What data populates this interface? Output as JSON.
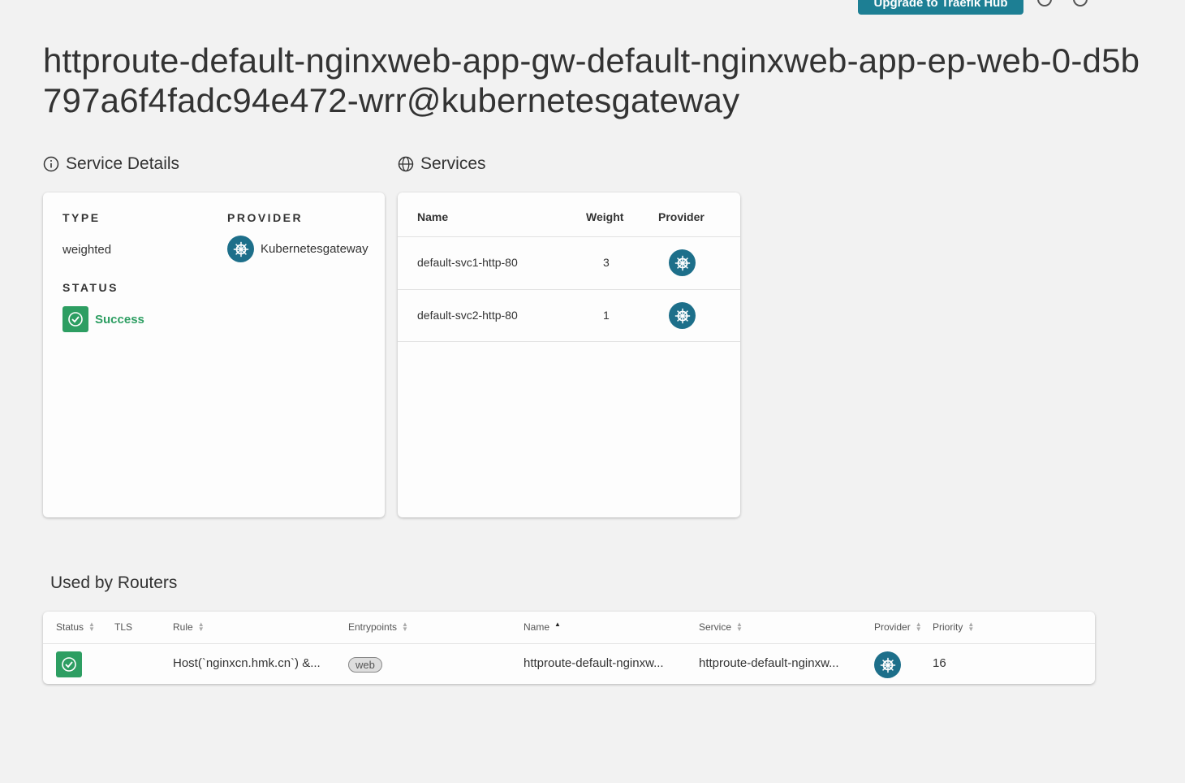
{
  "header": {
    "upgrade_label": "Upgrade to Traefik Hub"
  },
  "page": {
    "title": "httproute-default-nginxweb-app-gw-default-nginxweb-app-ep-web-0-d5b797a6f4fadc94e472-wrr@kubernetesgateway"
  },
  "service_details": {
    "heading": "Service Details",
    "type_label": "TYPE",
    "type_value": "weighted",
    "provider_label": "PROVIDER",
    "provider_value": "Kubernetesgateway",
    "status_label": "STATUS",
    "status_value": "Success"
  },
  "services": {
    "heading": "Services",
    "columns": [
      "Name",
      "Weight",
      "Provider"
    ],
    "rows": [
      {
        "name": "default-svc1-http-80",
        "weight": "3"
      },
      {
        "name": "default-svc2-http-80",
        "weight": "1"
      }
    ]
  },
  "routers": {
    "heading": "Used by Routers",
    "columns": [
      "Status",
      "TLS",
      "Rule",
      "Entrypoints",
      "Name",
      "Service",
      "Provider",
      "Priority"
    ],
    "rows": [
      {
        "rule": "Host(`nginxcn.hmk.cn`) &...",
        "entrypoint": "web",
        "name": "httproute-default-nginxw...",
        "service": "httproute-default-nginxw...",
        "priority": "16"
      }
    ]
  },
  "colors": {
    "accent": "#1d7f94",
    "success": "#2d9e62",
    "provider_icon_bg": "#1d6f8a"
  }
}
